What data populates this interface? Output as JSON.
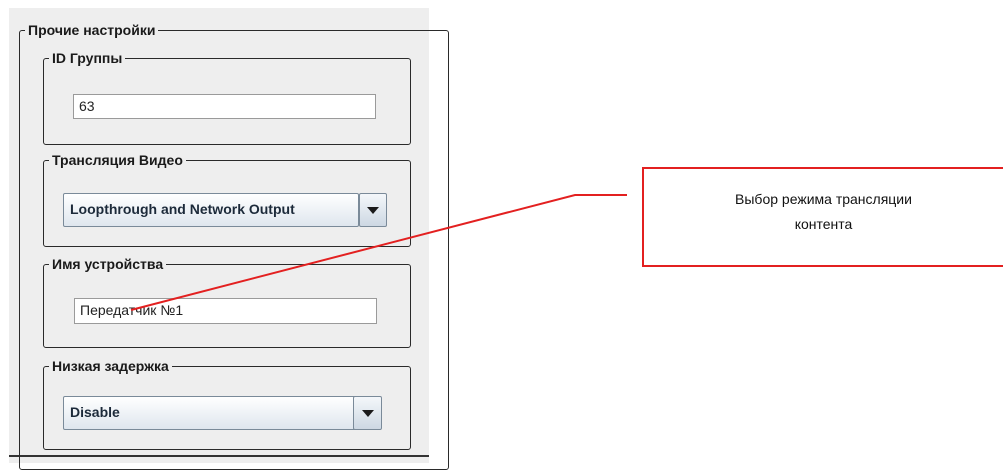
{
  "settings": {
    "title": "Прочие настройки",
    "group_id": {
      "label": "ID Группы",
      "value": "63"
    },
    "video": {
      "label": "Трансляция Видео",
      "selected": "Loopthrough and Network Output"
    },
    "device_name": {
      "label": "Имя устройства",
      "value": "Передатчик №1"
    },
    "low_latency": {
      "label": "Низкая задержка",
      "selected": "Disable"
    }
  },
  "annotation": {
    "text_line1": "Выбор режима трансляции",
    "text_line2": "контента",
    "color": "#e32020"
  },
  "icons": {
    "dropdown": "chevron-down-icon"
  }
}
